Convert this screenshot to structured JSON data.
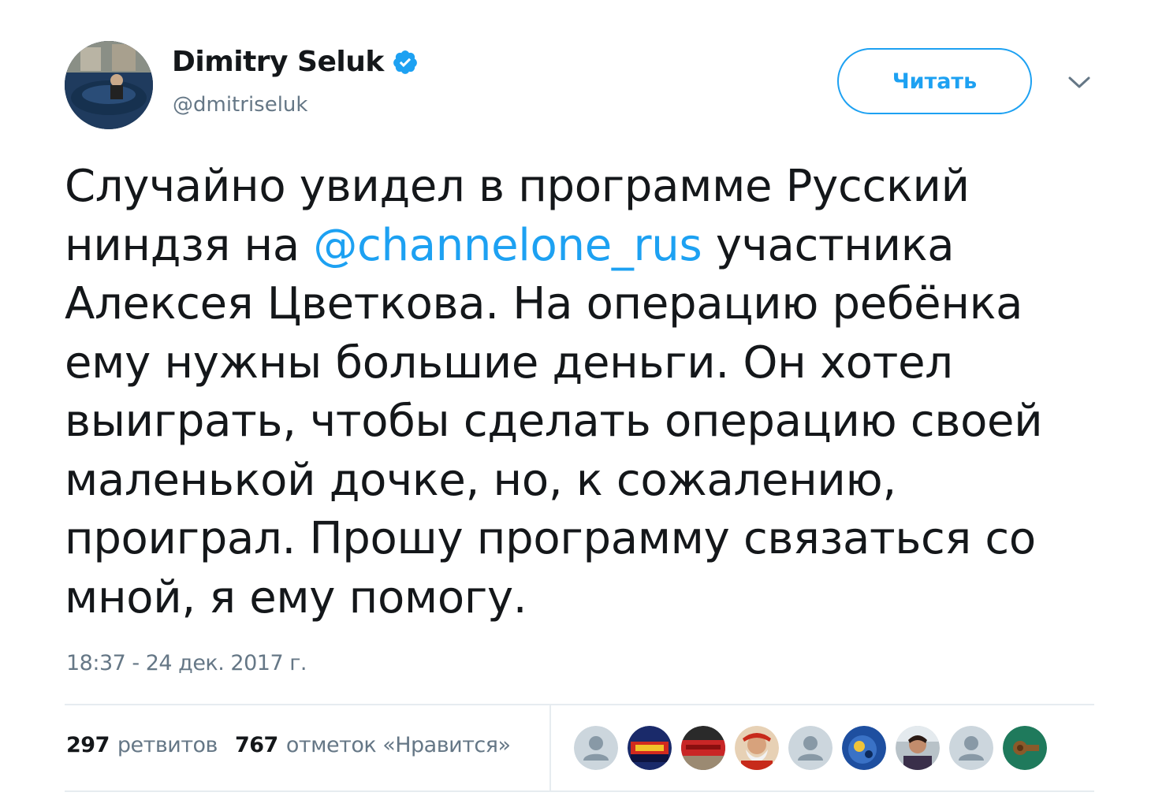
{
  "user": {
    "display_name": "Dimitry Seluk",
    "handle": "@dmitriseluk",
    "verified": true,
    "avatar_icon": "profile-photo"
  },
  "follow_button": {
    "label": "Читать"
  },
  "menu": {
    "icon": "chevron-down-icon"
  },
  "tweet": {
    "lines": [
      "Случайно увидел в программе Русский",
      "ниндзя на ",
      " участника",
      "Алексея Цветкова. На операцию ребёнка",
      "ему нужны большие деньги. Он хотел",
      "выиграть, чтобы сделать операцию своей",
      "маленькой дочке, но, к сожалению,",
      "проиграл. Прошу программу связаться со",
      "мной, я ему помогу."
    ],
    "mention": "@channelone_rus"
  },
  "timestamp": "18:37 - 24 дек. 2017 г.",
  "stats": {
    "retweets_count": "297",
    "retweets_label": "ретвитов",
    "likes_count": "767",
    "likes_label": "отметок «Нравится»"
  },
  "likers": [
    {
      "kind": "default-avatar-icon"
    },
    {
      "kind": "photo-avatar"
    },
    {
      "kind": "photo-avatar"
    },
    {
      "kind": "photo-avatar"
    },
    {
      "kind": "default-avatar-icon"
    },
    {
      "kind": "photo-avatar"
    },
    {
      "kind": "photo-avatar"
    },
    {
      "kind": "default-avatar-icon"
    },
    {
      "kind": "photo-avatar"
    }
  ],
  "colors": {
    "accent": "#1da1f2",
    "text": "#14171a",
    "muted": "#657786",
    "divider": "#e6ecf0"
  }
}
